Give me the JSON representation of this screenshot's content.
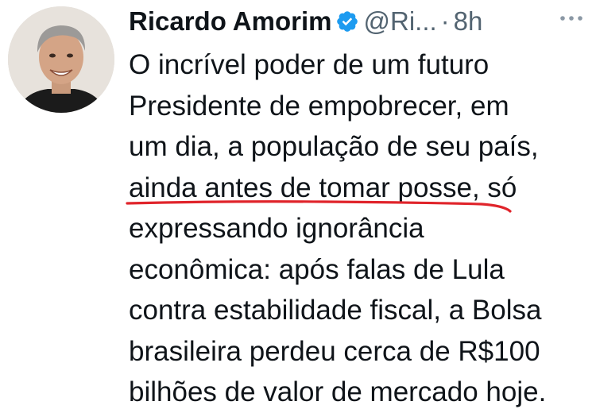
{
  "tweet": {
    "display_name": "Ricardo Amorim",
    "handle": "@Ri...",
    "separator": "·",
    "time": "8h",
    "verified": true,
    "avatar_icon": "profile-photo",
    "more_icon": "more-horizontal-icon",
    "accent_color": "#1d9bf0",
    "underline_color": "#e0242b",
    "lines": {
      "l1": "O incrível poder de um futuro",
      "l2": "Presidente de empobrecer, em",
      "l3": "um dia, a população de seu país,",
      "l4_underlined": "ainda antes de tomar posse",
      "l4_rest": ", só",
      "l5": "expressando ignorância",
      "l6": "econômica: após falas de Lula",
      "l7": "contra estabilidade fiscal, a Bolsa",
      "l8": "brasileira perdeu cerca de R$100",
      "l9": "bilhões de valor de mercado hoje."
    }
  }
}
